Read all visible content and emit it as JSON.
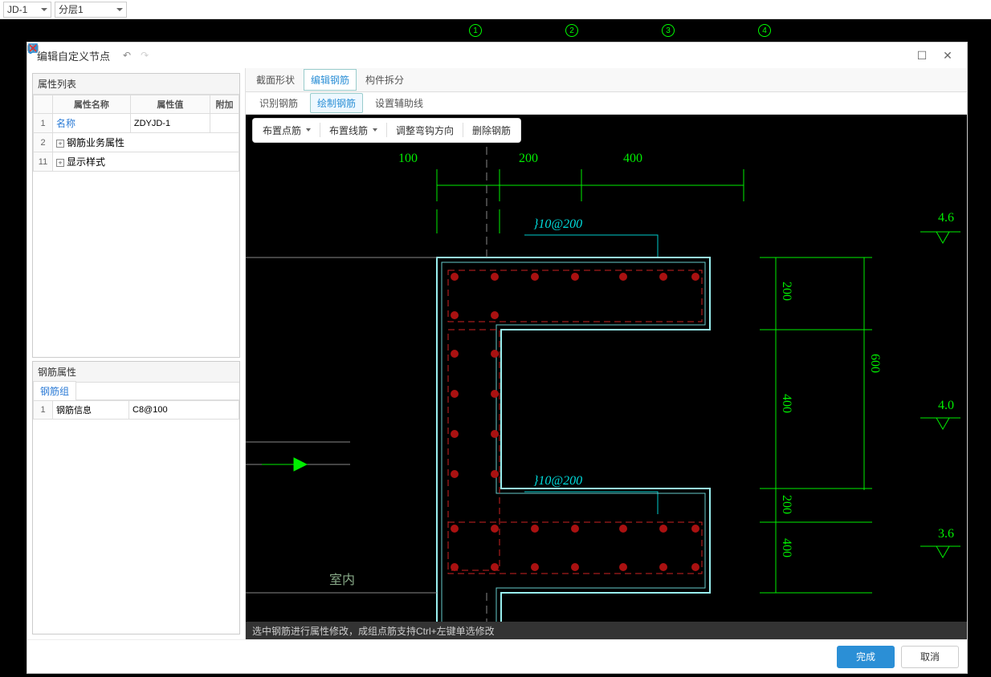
{
  "toolbar": {
    "drop1": "JD-1",
    "drop2": "分层1"
  },
  "axes": [
    "1",
    "2",
    "3",
    "4"
  ],
  "dialog": {
    "title": "编辑自定义节点",
    "left": {
      "prop_header": "属性列表",
      "columns": {
        "c1": "属性名称",
        "c2": "属性值",
        "c3": "附加"
      },
      "rows": [
        {
          "idx": "1",
          "name": "名称",
          "value": "ZDYJD-1",
          "link": true
        },
        {
          "idx": "2",
          "name": "钢筋业务属性",
          "value": "",
          "exp": true
        },
        {
          "idx": "11",
          "name": "显示样式",
          "value": "",
          "exp": true
        }
      ],
      "rebar_header": "钢筋属性",
      "rebar_tab": "钢筋组",
      "rebar_rows": [
        {
          "idx": "1",
          "name": "钢筋信息",
          "value": "C8@100"
        }
      ]
    },
    "mode_tabs": [
      {
        "label": "截面形状",
        "active": false
      },
      {
        "label": "编辑钢筋",
        "active": true
      },
      {
        "label": "构件拆分",
        "active": false
      }
    ],
    "sub_tabs": [
      {
        "label": "识别钢筋",
        "active": false
      },
      {
        "label": "绘制钢筋",
        "active": true
      },
      {
        "label": "设置辅助线",
        "active": false
      }
    ],
    "tool_buttons": {
      "b1": "布置点筋",
      "b2": "布置线筋",
      "b3": "调整弯钩方向",
      "b4": "删除钢筋"
    },
    "cad": {
      "dims": {
        "d1": "100",
        "d2": "200",
        "d3": "400"
      },
      "cyan_labels": [
        "}10@200",
        "}10@200"
      ],
      "side_dims": [
        "200",
        "400",
        "200",
        "400"
      ],
      "side_total": "600",
      "elev": [
        "4.6",
        "4.0",
        "3.6"
      ],
      "room": "室内"
    },
    "status": "选中钢筋进行属性修改，成组点筋支持Ctrl+左键单选修改",
    "footer": {
      "ok": "完成",
      "cancel": "取消"
    }
  }
}
